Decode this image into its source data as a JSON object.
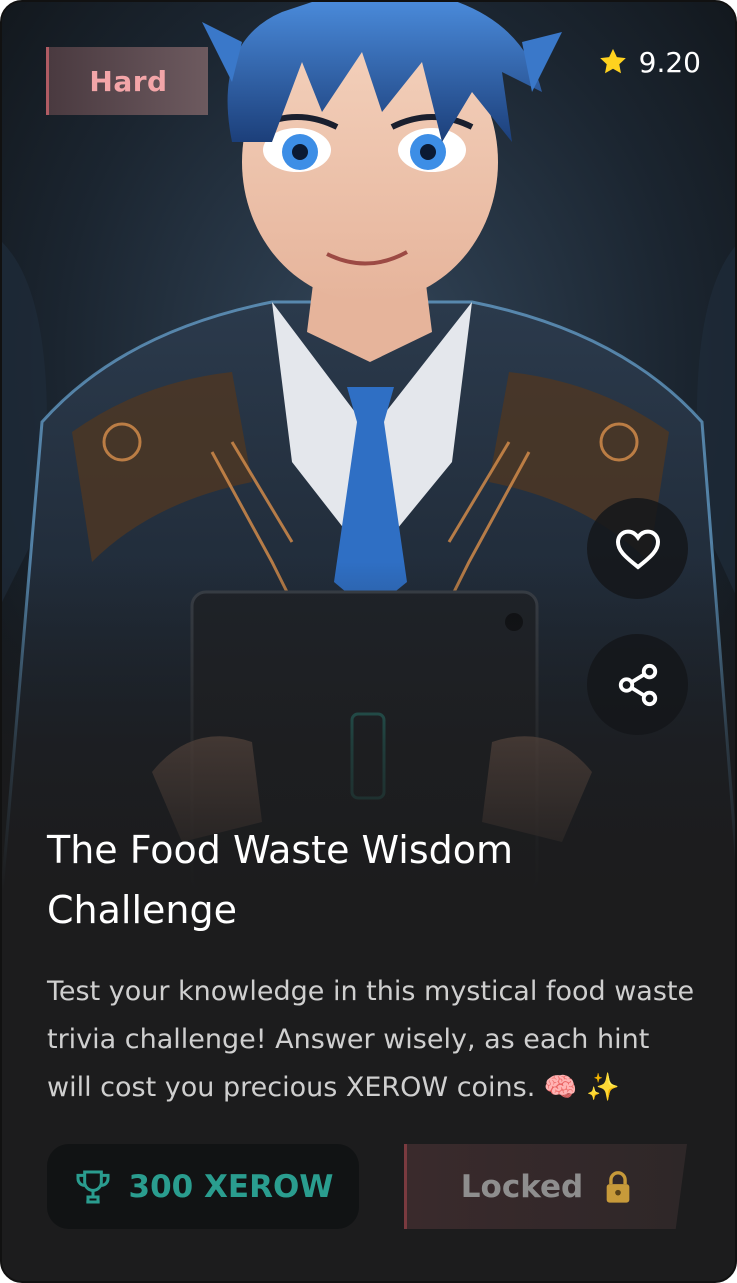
{
  "quiz": {
    "difficulty": "Hard",
    "rating": "9.20",
    "title": "The Food Waste Wisdom Challenge",
    "description": "Test your knowledge in this mystical food waste trivia challenge! Answer wisely, as each hint will cost you precious XEROW coins. 🧠 ✨",
    "reward": "300 XEROW",
    "status": "Locked"
  },
  "icons": {
    "rating": "star-icon",
    "favorite": "heart-icon",
    "share": "share-icon",
    "reward": "trophy-icon",
    "status": "lock-icon",
    "hero": "anime-character-illustration"
  },
  "colors": {
    "card_bg": "#1c1c1d",
    "difficulty_text": "#f3a5a8",
    "star": "#ffd21f",
    "reward_text": "#2a9d8f",
    "lock": "#c79a3a"
  }
}
